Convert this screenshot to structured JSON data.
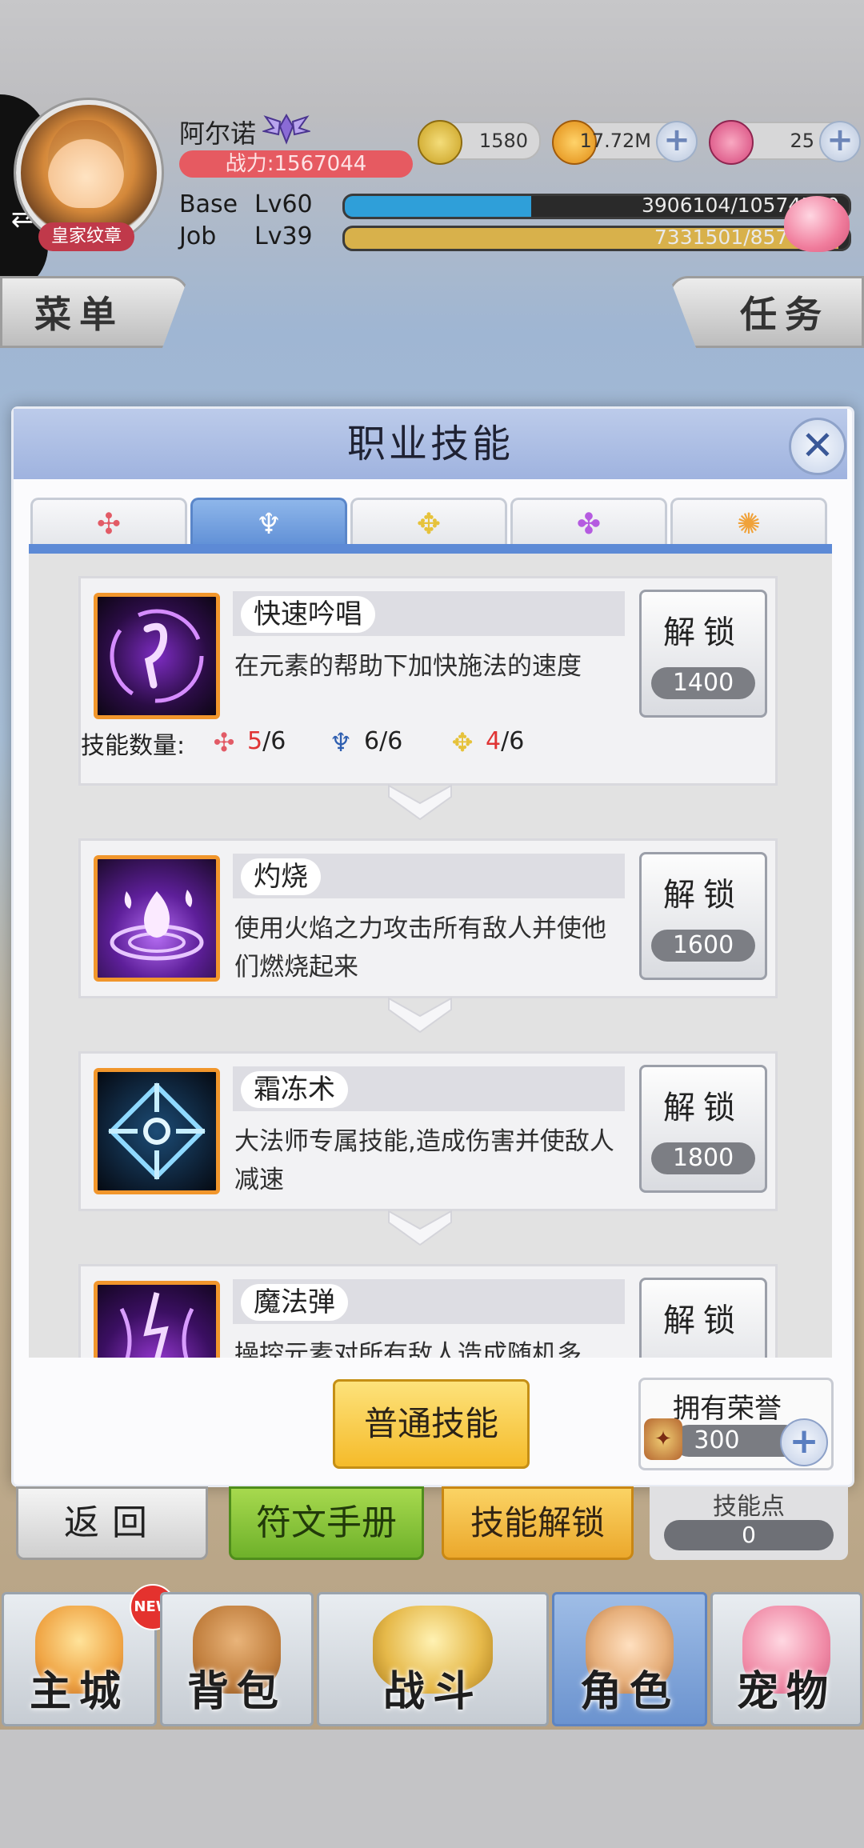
{
  "player": {
    "name": "阿尔诺",
    "power": "战力:1567044",
    "badge": "皇家纹章",
    "base_label": "Base",
    "base_level": "Lv60",
    "base_exp": "3906104/10574560",
    "base_exp_fraction": 0.37,
    "job_label": "Job",
    "job_level": "Lv39",
    "job_exp": "7331501/8570000",
    "job_exp_fraction": 0.98
  },
  "currency": {
    "zeny": "1580",
    "gold": "17.72M",
    "gem": "25"
  },
  "side_buttons": {
    "menu": "菜单",
    "task": "任务"
  },
  "dialog": {
    "title": "职业技能",
    "close_icon": "close-icon",
    "tabs": [
      {
        "icon": "red-emblem-icon",
        "color": "#e25b66",
        "active": false
      },
      {
        "icon": "blue-trident-icon",
        "color": "#2f5fb0",
        "active": true
      },
      {
        "icon": "yellow-emblem-icon",
        "color": "#e6c23a",
        "active": false
      },
      {
        "icon": "purple-emblem-icon",
        "color": "#b55be0",
        "active": false
      },
      {
        "icon": "orange-swirl-icon",
        "color": "#f0a23a",
        "active": false
      }
    ],
    "skills": [
      {
        "name": "快速吟唱",
        "desc": "在元素的帮助下加快施法的速度",
        "unlock": "解锁",
        "cost": "1400"
      },
      {
        "name": "灼烧",
        "desc": "使用火焰之力攻击所有敌人并使他们燃烧起来",
        "unlock": "解锁",
        "cost": "1600"
      },
      {
        "name": "霜冻术",
        "desc": "大法师专属技能,造成伤害并使敌人减速",
        "unlock": "解锁",
        "cost": "1800"
      },
      {
        "name": "魔法弹",
        "desc": "操控元素对所有敌人造成随机多",
        "unlock": "解锁"
      }
    ],
    "skill_count": {
      "label": "技能数量:",
      "red": {
        "have": "5",
        "total": "/6"
      },
      "blue": {
        "have": "6",
        "total": "/6"
      },
      "yellow": {
        "have": "4",
        "total": "/6"
      }
    },
    "normal_skill_button": "普通技能",
    "honor": {
      "title": "拥有荣誉",
      "value": "300"
    }
  },
  "action_bar": {
    "back": "返回",
    "rune": "符文手册",
    "skill_unlock": "技能解锁",
    "skill_points_label": "技能点",
    "skill_points": "0"
  },
  "bottom_nav": {
    "new_badge": "NEW",
    "items": [
      {
        "label": "主城",
        "active": false
      },
      {
        "label": "背包",
        "active": false
      },
      {
        "label": "战斗",
        "active": false
      },
      {
        "label": "角色",
        "active": true
      },
      {
        "label": "宠物",
        "active": false
      }
    ]
  },
  "colors": {
    "accent_blue": "#5d8ad6",
    "unlock_orange": "#f1962c",
    "power_red": "#e65a61",
    "base_bar": "#2f9fd9",
    "job_bar": "#d8b14b"
  }
}
